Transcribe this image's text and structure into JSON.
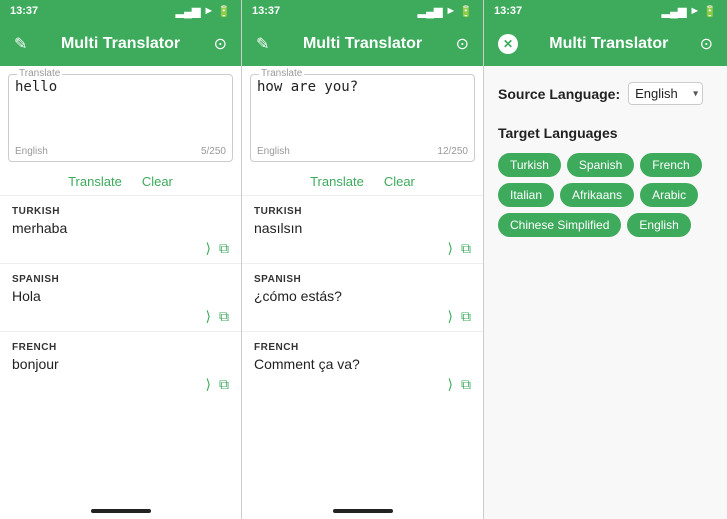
{
  "panels": [
    {
      "id": "panel1",
      "statusBar": {
        "time": "13:37",
        "signal": "▂▄▆",
        "wifi": "WiFi",
        "battery": "⚡"
      },
      "header": {
        "title": "Multi Translator",
        "editIcon": "✎",
        "historyIcon": "⊙"
      },
      "inputArea": {
        "label": "Translate",
        "text": "hello",
        "counter": "5/250",
        "langLabel": "English"
      },
      "actions": {
        "translate": "Translate",
        "clear": "Clear"
      },
      "translations": [
        {
          "lang": "TURKISH",
          "text": "merhaba"
        },
        {
          "lang": "SPANISH",
          "text": "Hola"
        },
        {
          "lang": "FRENCH",
          "text": "bonjour"
        }
      ]
    },
    {
      "id": "panel2",
      "statusBar": {
        "time": "13:37",
        "signal": "▂▄▆",
        "wifi": "WiFi",
        "battery": "⚡"
      },
      "header": {
        "title": "Multi Translator",
        "editIcon": "✎",
        "historyIcon": "⊙"
      },
      "inputArea": {
        "label": "Translate",
        "text": "how are you?",
        "counter": "12/250",
        "langLabel": "English"
      },
      "actions": {
        "translate": "Translate",
        "clear": "Clear"
      },
      "translations": [
        {
          "lang": "TURKISH",
          "text": "nasılsın"
        },
        {
          "lang": "SPANISH",
          "text": "¿cómo estás?"
        },
        {
          "lang": "FRENCH",
          "text": "Comment ça va?"
        }
      ]
    }
  ],
  "settingsPanel": {
    "statusBar": {
      "time": "13:37",
      "signal": "▂▄▆",
      "wifi": "WiFi",
      "battery": "⚡"
    },
    "header": {
      "title": "Multi Translator",
      "historyIcon": "⊙"
    },
    "sourceLanguage": {
      "label": "Source Language:",
      "value": "English"
    },
    "targetLanguages": {
      "title": "Target Languages",
      "tags": [
        "Turkish",
        "Spanish",
        "French",
        "Italian",
        "Afrikaans",
        "Arabic",
        "Chinese Simplified",
        "English"
      ]
    }
  },
  "icons": {
    "share": "⎙",
    "copy": "⧉",
    "edit": "✎",
    "history": "⊙",
    "close": "✕",
    "dropdownArrow": "▾"
  }
}
